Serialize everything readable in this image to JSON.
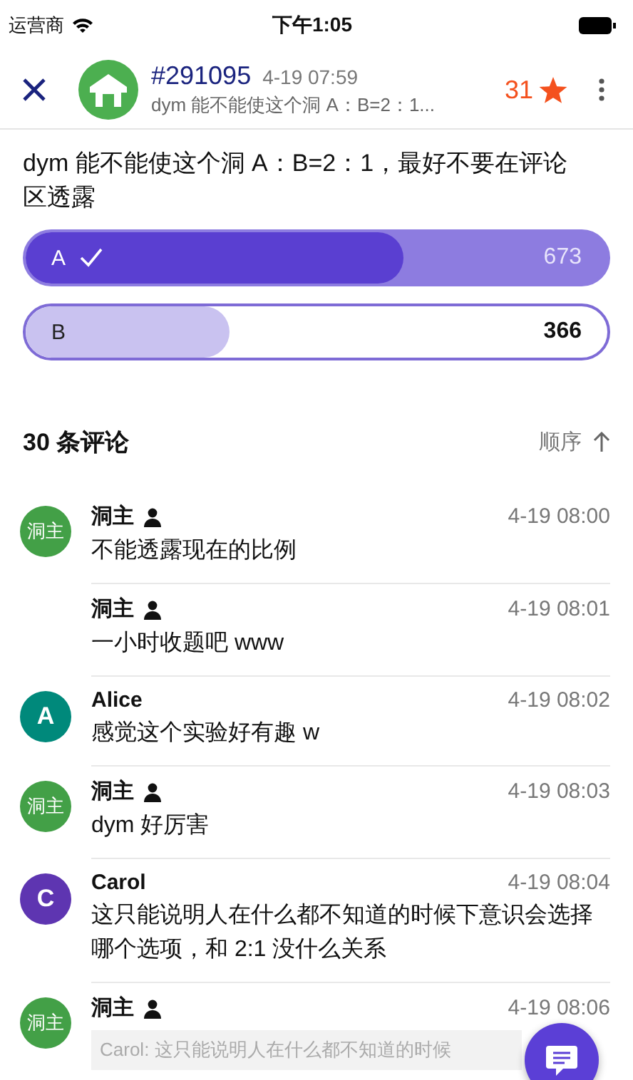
{
  "status_bar": {
    "carrier": "运营商",
    "time": "下午1:05"
  },
  "header": {
    "post_id": "#291095",
    "time": "4-19 07:59",
    "subtitle": "dym 能不能使这个洞 A：B=2：1...",
    "star_count": "31",
    "starred": true
  },
  "post": {
    "text": "dym 能不能使这个洞 A：B=2：1，最好不要在评论区透露"
  },
  "poll": [
    {
      "label": "A",
      "votes": "673",
      "selected": true,
      "level": 0.65
    },
    {
      "label": "B",
      "votes": "366",
      "selected": false,
      "level": 0.35
    }
  ],
  "comments_header": {
    "count": "30 条评论",
    "sort": "顺序"
  },
  "comments": [
    {
      "avatar": {
        "text": "洞主",
        "color": "#43a047"
      },
      "author": "洞主",
      "is_op": true,
      "time": "4-19 08:00",
      "text": "不能透露现在的比例"
    },
    {
      "author": "洞主",
      "is_op": true,
      "time": "4-19 08:01",
      "text": "一小时收题吧 www"
    },
    {
      "avatar": {
        "text": "A",
        "color": "#00897b"
      },
      "author": "Alice",
      "is_op": false,
      "time": "4-19 08:02",
      "text": "感觉这个实验好有趣 w"
    },
    {
      "avatar": {
        "text": "洞主",
        "color": "#43a047"
      },
      "author": "洞主",
      "is_op": true,
      "time": "4-19 08:03",
      "text": "dym 好厉害"
    },
    {
      "avatar": {
        "text": "C",
        "color": "#5e35b1"
      },
      "author": "Carol",
      "is_op": false,
      "time": "4-19 08:04",
      "text": "这只能说明人在什么都不知道的时候下意识会选择哪个选项，和 2:1 没什么关系"
    },
    {
      "avatar": {
        "text": "洞主",
        "color": "#43a047"
      },
      "author": "洞主",
      "is_op": true,
      "time": "4-19 08:06",
      "quote": "Carol: 这只能说明人在什么都不知道的时候"
    }
  ]
}
